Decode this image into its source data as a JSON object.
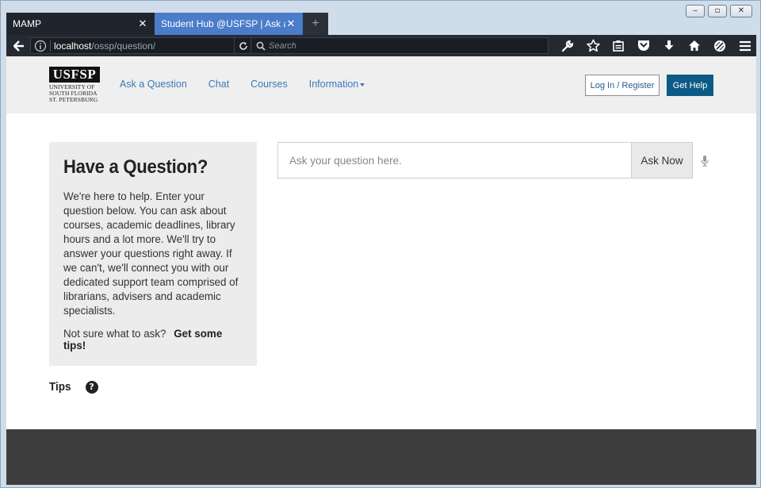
{
  "window": {
    "controls": [
      "minimize",
      "maximize",
      "close"
    ]
  },
  "tabs": [
    {
      "title": "MAMP",
      "active": false
    },
    {
      "title": "Student Hub @USFSP | Ask a Que",
      "active": true
    }
  ],
  "navbar": {
    "url_host": "localhost",
    "url_path": "/ossp/question/",
    "search_placeholder": "Search",
    "toolbar_icons": [
      "wrench-icon",
      "bookmark-star-icon",
      "clipboard-icon",
      "pocket-icon",
      "download-icon",
      "home-icon",
      "compass-icon",
      "menu-icon"
    ]
  },
  "site": {
    "logo": {
      "mark": "USFSP",
      "lines": [
        "UNIVERSITY OF",
        "SOUTH FLORIDA",
        "ST. PETERSBURG"
      ]
    },
    "nav": [
      "Ask a Question",
      "Chat",
      "Courses",
      "Information"
    ],
    "login_label": "Log In / Register",
    "help_label": "Get Help"
  },
  "panel": {
    "title": "Have a Question?",
    "body": "We're here to help. Enter your question below. You can ask about courses, academic deadlines, library hours and a lot more. We'll try to answer your questions right away. If we can't, we'll connect you with our dedicated support team comprised of librarians, advisers and academic specialists.",
    "tips_prompt": "Not sure what to ask?",
    "tips_link": "Get some tips!"
  },
  "ask": {
    "placeholder": "Ask your question here.",
    "button": "Ask Now"
  },
  "tips": {
    "heading": "Tips",
    "icon_glyph": "?"
  }
}
